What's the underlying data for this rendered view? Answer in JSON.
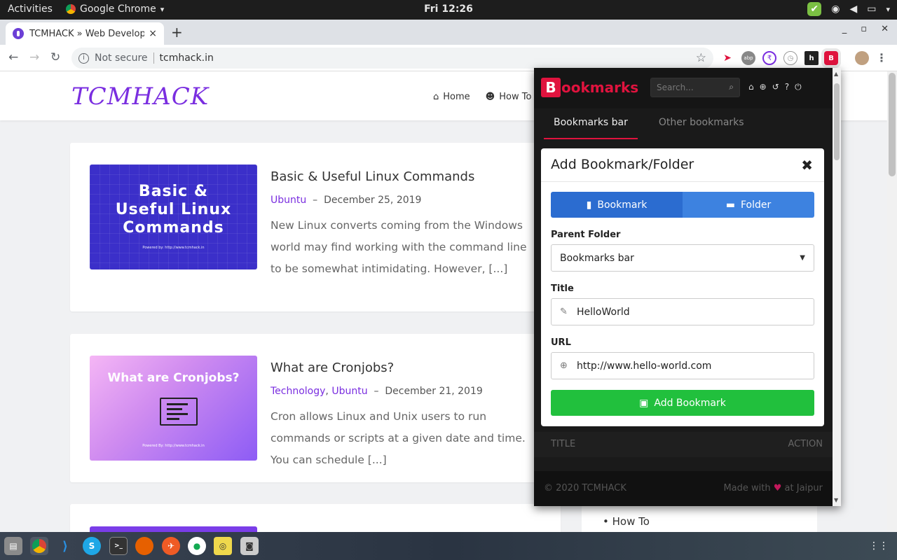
{
  "topbar": {
    "activities": "Activities",
    "app_name": "Google Chrome",
    "app_caret": "▾",
    "clock": "Fri 12:26",
    "tray_icons": [
      "checkmark-icon",
      "wifi-icon",
      "volume-icon",
      "battery-icon",
      "caret-down-icon"
    ]
  },
  "browser": {
    "tab_title": "TCMHACK » Web Developer",
    "tab_close": "×",
    "new_tab": "+",
    "window_controls": [
      "_",
      "▫",
      "✕"
    ],
    "security_text": "Not secure",
    "url": "tcmhack.in",
    "extensions": [
      "abp",
      "rupee",
      "clock",
      "h",
      "B"
    ]
  },
  "site": {
    "logo": "TCMHACK",
    "nav": [
      {
        "label": "Home",
        "icon": "home-icon"
      },
      {
        "label": "How To",
        "icon": "users-icon"
      }
    ],
    "posts": [
      {
        "thumb_title": "Basic & Useful Linux Commands",
        "thumb_line1": "Basic &",
        "thumb_line2": "Useful Linux",
        "thumb_line3": "Commands",
        "thumb_credit": "Powered by: http://www.tcmhack.in",
        "title": "Basic & Useful Linux Commands",
        "categories": [
          "Ubuntu"
        ],
        "date": "December 25, 2019",
        "excerpt": "New Linux converts coming from the Windows world may find working with the command line to be somewhat intimidating. However, [...]"
      },
      {
        "thumb_title": "What are Cronjobs?",
        "thumb_credit": "Powered By: http://www.tcmhack.in",
        "title": "What are Cronjobs?",
        "cat1": "Technology",
        "cat2": "Ubuntu",
        "date": "December 21, 2019",
        "excerpt": "Cron allows Linux and Unix users to run commands or scripts at a given date and time. You can schedule [...]"
      }
    ],
    "sidebar_item": "How To"
  },
  "popup": {
    "logo_letter": "B",
    "logo_word": "ookmarks",
    "search_placeholder": "Search...",
    "tabs": [
      "Bookmarks bar",
      "Other bookmarks"
    ],
    "table_headers": [
      "TITLE",
      "ACTION"
    ],
    "footer_left": "© 2020 TCMHACK",
    "footer_made": "Made with",
    "footer_heart": "♥",
    "footer_at": "at Jaipur",
    "modal": {
      "title": "Add Bookmark/Folder",
      "close": "✖",
      "type_bookmark": "Bookmark",
      "type_folder": "Folder",
      "parent_label": "Parent Folder",
      "parent_value": "Bookmarks bar",
      "title_label": "Title",
      "title_value": "HelloWorld",
      "url_label": "URL",
      "url_value": "http://www.hello-world.com",
      "submit": "Add Bookmark"
    }
  },
  "taskbar": {
    "apps": [
      "files-icon",
      "chrome-icon",
      "vscode-icon",
      "skype-icon",
      "terminal-icon",
      "firefox-icon",
      "postman-icon",
      "mongodb-icon",
      "robo3t-icon",
      "screenshot-icon"
    ]
  },
  "colors": {
    "accent_purple": "#7a2ee0",
    "bookmark_red": "#e0133e",
    "button_blue": "#2b6cd0",
    "button_green": "#21c03d"
  }
}
